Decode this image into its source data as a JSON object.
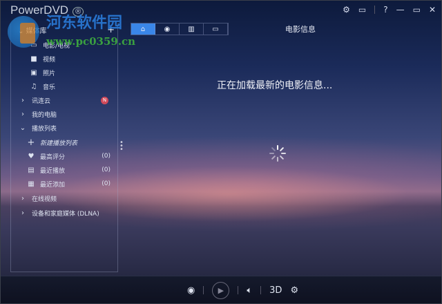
{
  "app": {
    "title": "PowerDVD",
    "reg": "®"
  },
  "window_controls": [
    "⚙",
    "📺",
    "?",
    "—",
    "▭",
    "✕"
  ],
  "watermark": {
    "name": "河东软件园",
    "url": "www.pc0359.cn"
  },
  "sidebar": {
    "header": "媒体库",
    "add": "+",
    "items": [
      {
        "label": "电影/电视",
        "icon": "movie-tv-icon"
      },
      {
        "label": "视频",
        "icon": "video-camera-icon"
      },
      {
        "label": "照片",
        "icon": "photo-icon"
      },
      {
        "label": "音乐",
        "icon": "music-icon"
      },
      {
        "label": "讯连云",
        "badge": "N"
      },
      {
        "label": "我的电脑"
      },
      {
        "label": "播放列表"
      },
      {
        "label": "新建播放列表"
      },
      {
        "label": "最高评分",
        "count": "(0)"
      },
      {
        "label": "最近播放",
        "count": "(0)"
      },
      {
        "label": "最近添加",
        "count": "(0)"
      },
      {
        "label": "在线视频"
      },
      {
        "label": "设备和家庭媒体 (DLNA)"
      }
    ]
  },
  "tabs": [
    "home",
    "disc",
    "film",
    "tv"
  ],
  "main": {
    "title": "电影信息",
    "loading": "正在加载最新的电影信息..."
  },
  "bottom": {
    "three_d": "3D"
  },
  "colors": {
    "accent": "#3a86e8"
  }
}
